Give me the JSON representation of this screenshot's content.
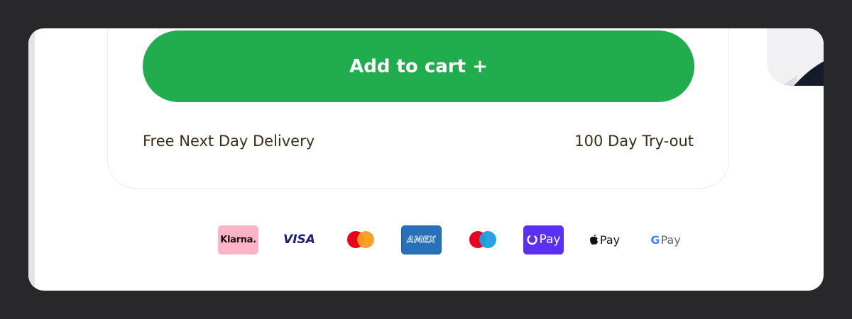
{
  "product_card": {
    "add_to_cart_label": "Add to cart +",
    "perk_left": "Free Next Day Delivery",
    "perk_right": "100 Day Try-out"
  },
  "payment_methods": {
    "klarna": "Klarna.",
    "visa": "VISA",
    "amex": "AMEX",
    "shop_pay": "Pay",
    "apple_pay": "Pay",
    "google_pay_g": "G",
    "google_pay": "Pay"
  },
  "colors": {
    "button": "#21ad4d",
    "perk_text": "#3d2e12",
    "background": "#28282b",
    "klarna": "#ffb3c7",
    "amex": "#2671b9",
    "shop_pay": "#5a31f4"
  }
}
